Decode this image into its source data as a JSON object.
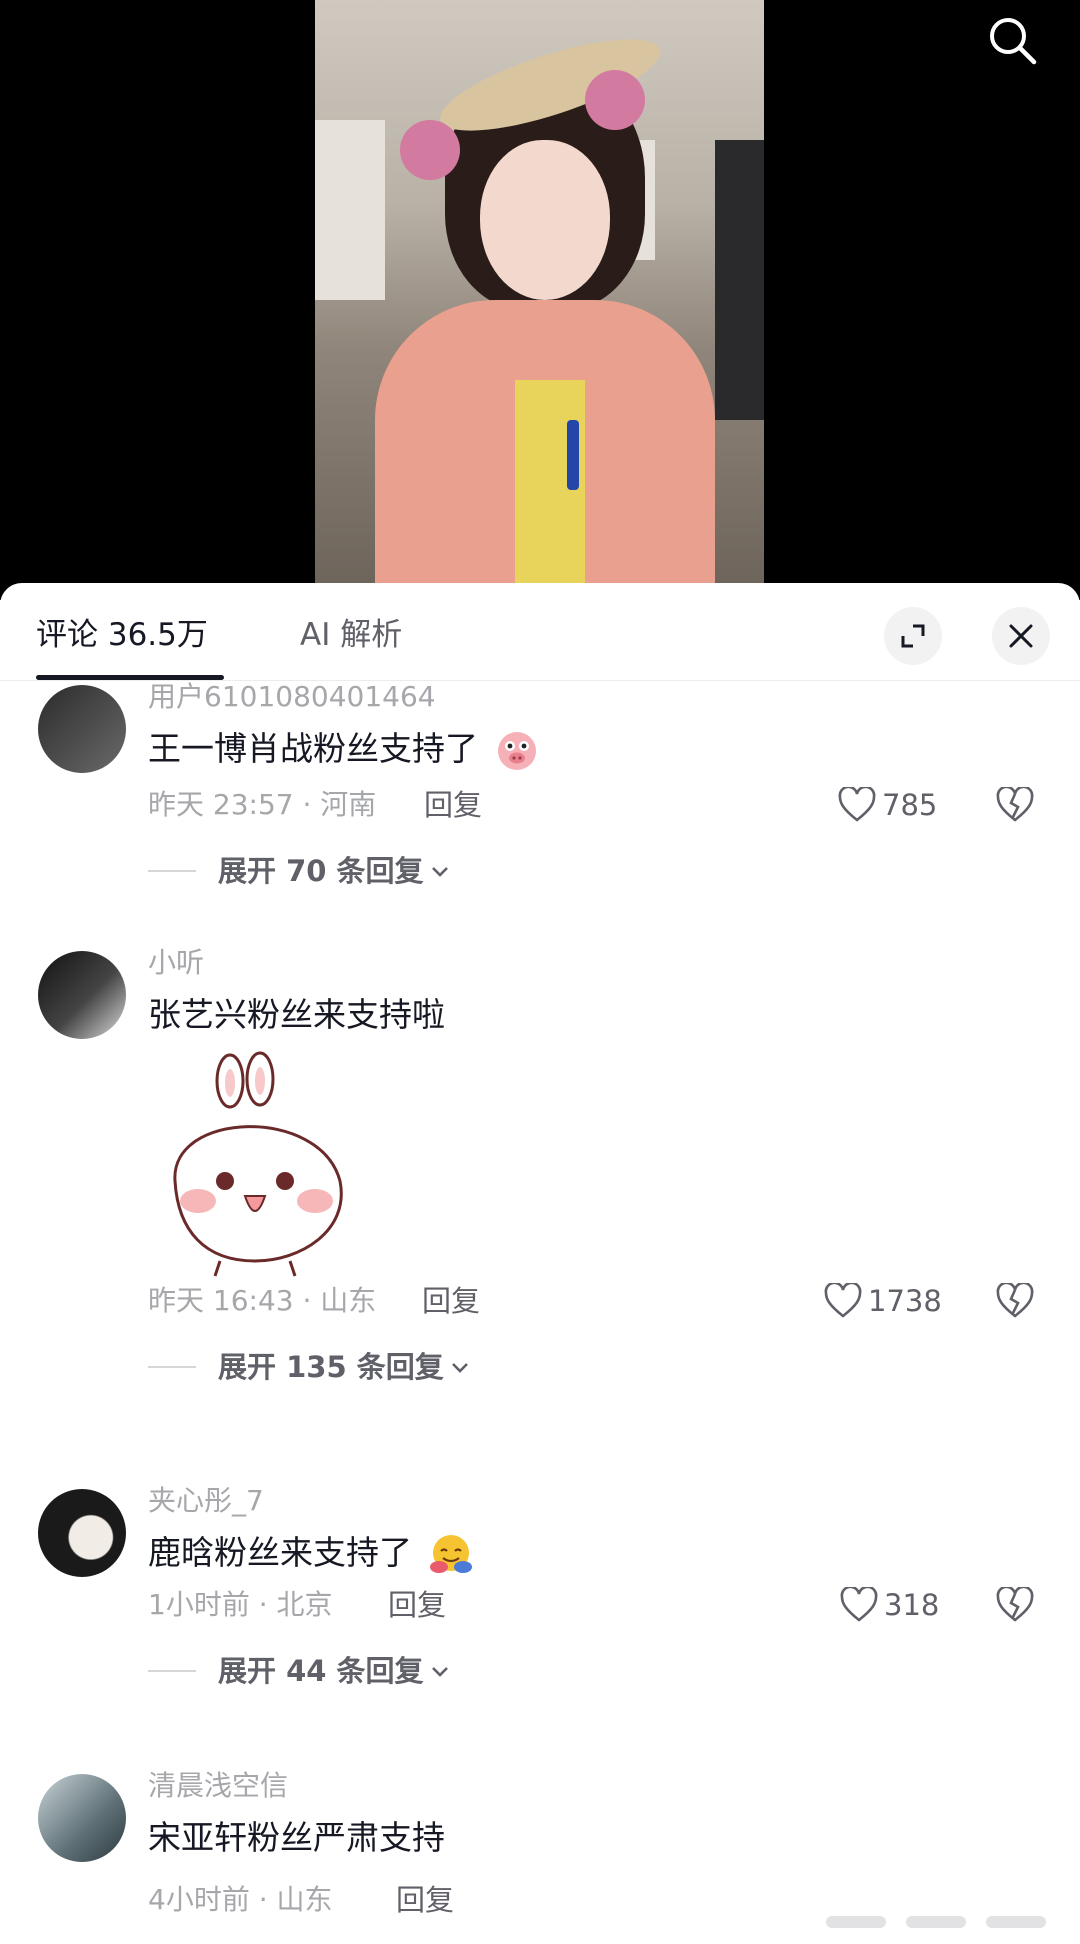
{
  "header": {
    "tab_comments_label": "评论 36.5万",
    "tab_ai_label": "AI 解析"
  },
  "colors": {
    "primary_text": "#161823",
    "secondary_text": "#a6a7ab",
    "muted_text": "#5f6068",
    "panel_bg": "#ffffff",
    "video_bg": "#000000"
  },
  "comments": [
    {
      "username": "用户6101080401464",
      "text": "王一博肖战粉丝支持了",
      "emoji": "pig-face-emoji",
      "time_location": "昨天 23:57 · 河南",
      "reply_label": "回复",
      "like_count": "785",
      "expand_label": "展开 70 条回复"
    },
    {
      "username": "小听",
      "text": "张艺兴粉丝来支持啦",
      "sticker": "bunny-sticker",
      "time_location": "昨天 16:43 · 山东",
      "reply_label": "回复",
      "like_count": "1738",
      "expand_label": "展开 135 条回复"
    },
    {
      "username": "夹心彤_7",
      "text": "鹿晗粉丝来支持了",
      "emoji": "hugging-face-emoji",
      "time_location": "1小时前 · 北京",
      "reply_label": "回复",
      "like_count": "318",
      "expand_label": "展开 44 条回复"
    },
    {
      "username": "清晨浅空信",
      "text": "宋亚轩粉丝严肃支持",
      "time_location": "4小时前 · 山东",
      "reply_label": "回复"
    }
  ],
  "icons": {
    "search": "search-icon",
    "expand": "expand-icon",
    "close": "close-icon",
    "like": "heart-icon",
    "dislike": "broken-heart-icon",
    "chevron": "chevron-down-icon"
  }
}
